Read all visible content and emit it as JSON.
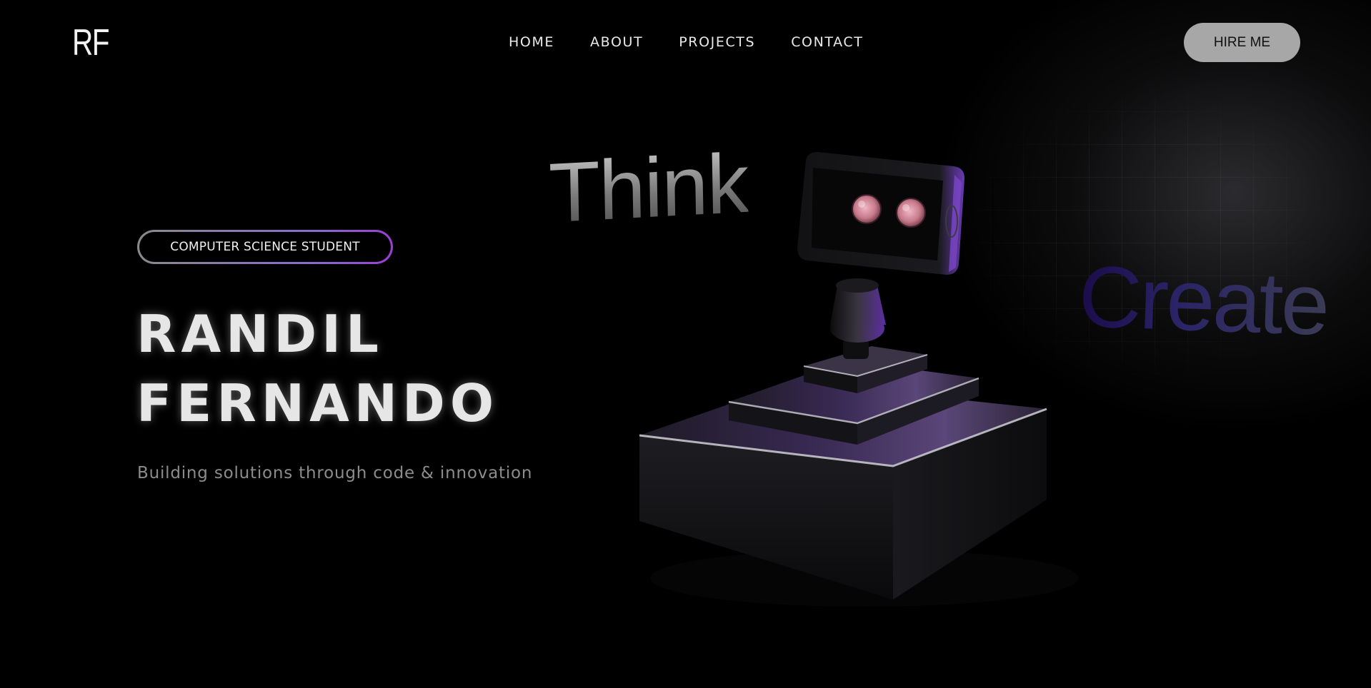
{
  "header": {
    "logo": "RF",
    "nav": [
      "HOME",
      "ABOUT",
      "PROJECTS",
      "CONTACT"
    ],
    "cta": "HIRE ME"
  },
  "hero": {
    "badge": "COMPUTER SCIENCE STUDENT",
    "name_line1": "RANDIL",
    "name_line2": "FERNANDO",
    "tagline": "Building solutions through code & innovation"
  },
  "scene": {
    "word_1": "Think",
    "word_2": "Create",
    "accent_color": "#7b3fd6"
  }
}
